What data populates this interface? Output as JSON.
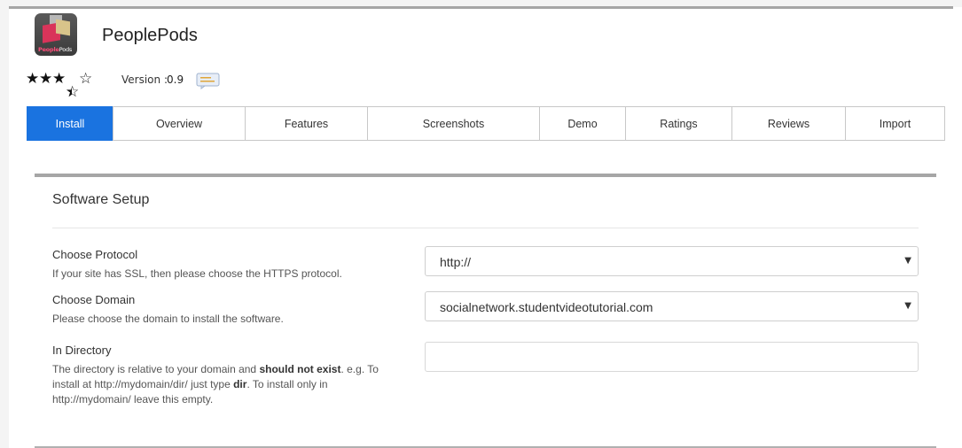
{
  "app": {
    "name": "PeoplePods",
    "logo_text_a": "People",
    "logo_text_b": "Pods",
    "rating_stars": 3.5,
    "rating_max": 5,
    "version_label": "Version :",
    "version_value": "0.9"
  },
  "tabs": [
    {
      "label": "Install",
      "active": true
    },
    {
      "label": "Overview",
      "active": false
    },
    {
      "label": "Features",
      "active": false
    },
    {
      "label": "Screenshots",
      "active": false
    },
    {
      "label": "Demo",
      "active": false
    },
    {
      "label": "Ratings",
      "active": false
    },
    {
      "label": "Reviews",
      "active": false
    },
    {
      "label": "Import",
      "active": false
    }
  ],
  "setup": {
    "title": "Software Setup",
    "protocol": {
      "label": "Choose Protocol",
      "help": "If your site has SSL, then please choose the HTTPS protocol.",
      "value": "http://"
    },
    "domain": {
      "label": "Choose Domain",
      "help": "Please choose the domain to install the software.",
      "value": "socialnetwork.studentvideotutorial.com"
    },
    "directory": {
      "label": "In Directory",
      "help_1": "The directory is relative to your domain and ",
      "help_bold_1": "should not exist",
      "help_2": ". e.g. To install at http://mydomain/dir/ just type ",
      "help_bold_2": "dir",
      "help_3": ". To install only in http://mydomain/ leave this empty.",
      "value": ""
    }
  },
  "colors": {
    "accent": "#1a73e0",
    "rule": "#a6a6a6"
  }
}
